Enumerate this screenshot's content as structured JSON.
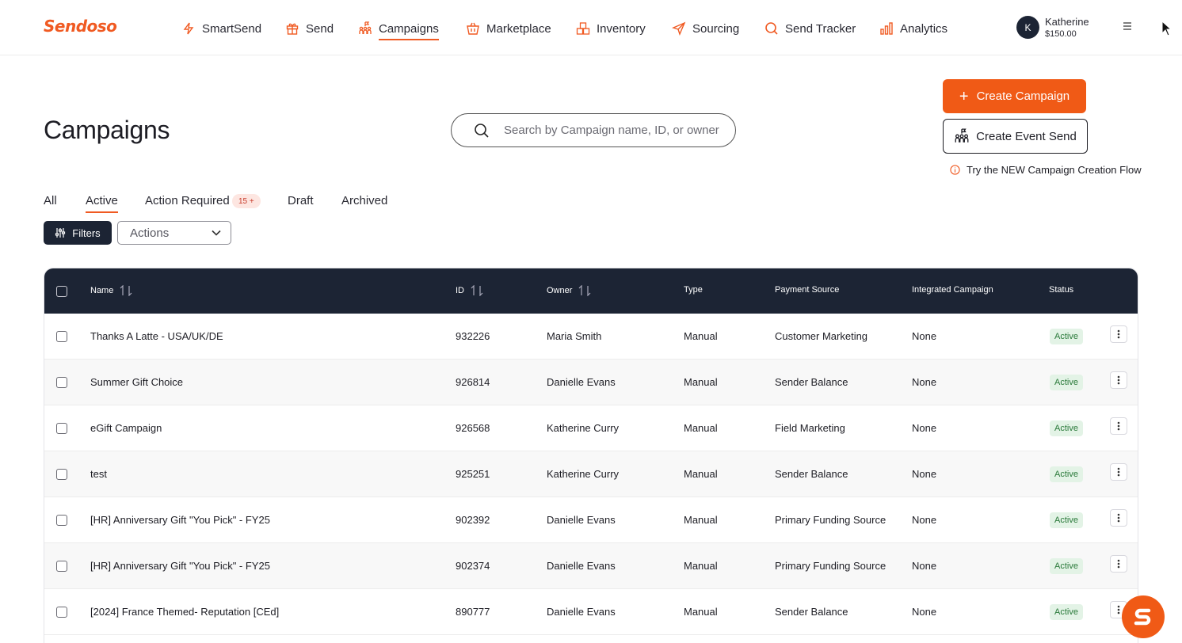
{
  "brand": {
    "logo": "Sendoso",
    "accent": "#f05a22",
    "dark": "#1c2434"
  },
  "nav": {
    "items": [
      {
        "label": "SmartSend",
        "icon": "bolt-icon"
      },
      {
        "label": "Send",
        "icon": "gift-icon"
      },
      {
        "label": "Campaigns",
        "icon": "people-flag-icon",
        "active": true
      },
      {
        "label": "Marketplace",
        "icon": "basket-icon"
      },
      {
        "label": "Inventory",
        "icon": "boxes-icon"
      },
      {
        "label": "Sourcing",
        "icon": "paper-plane-icon"
      },
      {
        "label": "Send Tracker",
        "icon": "search-icon"
      },
      {
        "label": "Analytics",
        "icon": "bar-chart-icon"
      }
    ],
    "user": {
      "initial": "K",
      "name": "Katherine",
      "balance": "$150.00"
    }
  },
  "page": {
    "title": "Campaigns",
    "search_placeholder": "Search by Campaign name, ID, or owner",
    "create_campaign_label": "Create Campaign",
    "create_event_label": "Create Event Send",
    "try_new_label": "Try the NEW Campaign Creation Flow"
  },
  "tabs": [
    {
      "label": "All"
    },
    {
      "label": "Active",
      "active": true
    },
    {
      "label": "Action Required",
      "badge": "15 +"
    },
    {
      "label": "Draft"
    },
    {
      "label": "Archived"
    }
  ],
  "toolbar": {
    "filters_label": "Filters",
    "actions_label": "Actions"
  },
  "table": {
    "columns": [
      "Name",
      "ID",
      "Owner",
      "Type",
      "Payment Source",
      "Integrated Campaign",
      "Status"
    ],
    "rows": [
      {
        "name": "Thanks A Latte - USA/UK/DE",
        "id": "932226",
        "owner": "Maria Smith",
        "type": "Manual",
        "payment": "Customer Marketing",
        "integrated": "None",
        "status": "Active"
      },
      {
        "name": "Summer Gift Choice",
        "id": "926814",
        "owner": "Danielle Evans",
        "type": "Manual",
        "payment": "Sender Balance",
        "integrated": "None",
        "status": "Active"
      },
      {
        "name": "eGift Campaign",
        "id": "926568",
        "owner": "Katherine Curry",
        "type": "Manual",
        "payment": "Field Marketing",
        "integrated": "None",
        "status": "Active"
      },
      {
        "name": "test",
        "id": "925251",
        "owner": "Katherine Curry",
        "type": "Manual",
        "payment": "Sender Balance",
        "integrated": "None",
        "status": "Active"
      },
      {
        "name": "[HR] Anniversary Gift \"You Pick\" - FY25",
        "id": "902392",
        "owner": "Danielle Evans",
        "type": "Manual",
        "payment": "Primary Funding Source",
        "integrated": "None",
        "status": "Active"
      },
      {
        "name": "[HR] Anniversary Gift \"You Pick\" - FY25",
        "id": "902374",
        "owner": "Danielle Evans",
        "type": "Manual",
        "payment": "Primary Funding Source",
        "integrated": "None",
        "status": "Active"
      },
      {
        "name": "[2024] France Themed- Reputation [CEd]",
        "id": "890777",
        "owner": "Danielle Evans",
        "type": "Manual",
        "payment": "Sender Balance",
        "integrated": "None",
        "status": "Active"
      }
    ]
  }
}
